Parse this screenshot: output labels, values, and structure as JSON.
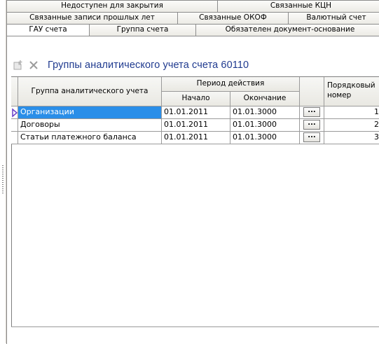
{
  "tabs": {
    "row1": [
      "Недоступен для закрытия",
      "Связанные КЦН"
    ],
    "row2": [
      "Связанные записи прошлых лет",
      "Связанные ОКОФ",
      "Валютный счет"
    ],
    "row3": [
      "ГАУ счета",
      "Группа счета",
      "Обязателен документ-основание"
    ]
  },
  "toolbar": {
    "add_icon": "add-document-icon",
    "delete_icon": "delete-x-icon",
    "title": "Группы аналитического учета счета 60110"
  },
  "grid": {
    "headers": {
      "group": "Группа аналитического учета",
      "period": "Период действия",
      "start": "Начало",
      "end": "Окончание",
      "order": "Порядковый номер"
    },
    "rows": [
      {
        "group": "Организации",
        "start": "01.01.2011",
        "end": "01.01.3000",
        "button": "...",
        "order": "1"
      },
      {
        "group": "Договоры",
        "start": "01.01.2011",
        "end": "01.01.3000",
        "button": "...",
        "order": "2"
      },
      {
        "group": "Статьи платежного баланса",
        "start": "01.01.2011",
        "end": "01.01.3000",
        "button": "...",
        "order": "3"
      }
    ]
  },
  "colors": {
    "accent_title": "#1f3a8f",
    "selection": "#2a8ee8",
    "row_marker": "#6a3fc8"
  }
}
